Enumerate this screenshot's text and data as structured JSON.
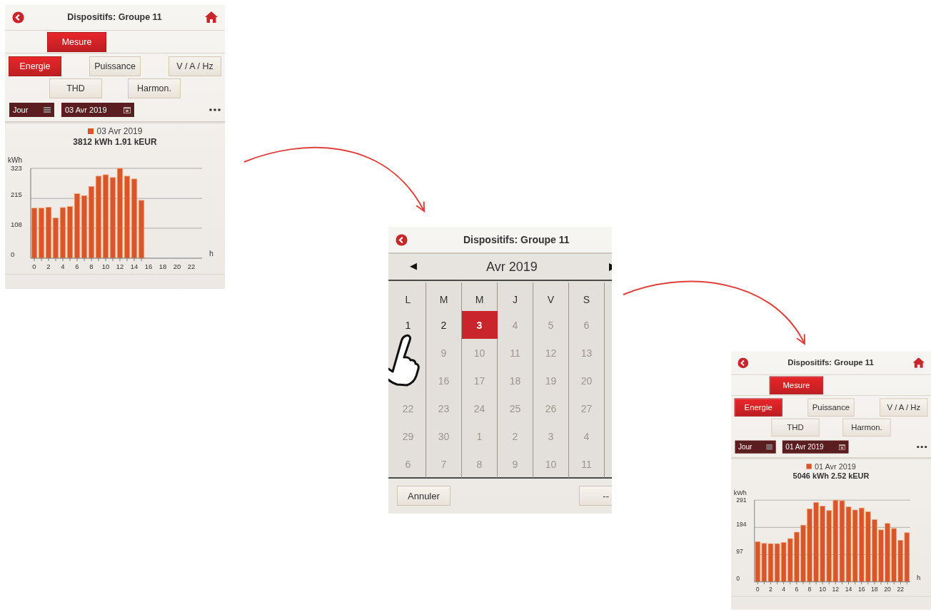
{
  "screens": [
    {
      "kind": "chart",
      "title": "Dispositifs: Groupe 11",
      "tabs": [
        {
          "label": "Mesure",
          "selected": true
        }
      ],
      "measure_rows": [
        [
          {
            "label": "Energie",
            "selected": true
          },
          {
            "label": "Puissance",
            "selected": false
          },
          {
            "label": "V / A / Hz",
            "selected": false
          }
        ],
        [
          {
            "label": "THD",
            "selected": false
          },
          {
            "label": "Harmon.",
            "selected": false
          }
        ]
      ],
      "period": "Jour",
      "date": "03 Avr 2019",
      "total": "3812 kWh 1.91 kEUR",
      "chart_data": {
        "type": "bar",
        "xlabel": "h",
        "ylabel": "kWh",
        "x": [
          0,
          1,
          2,
          3,
          4,
          5,
          6,
          7,
          8,
          9,
          10,
          11,
          12,
          13,
          14,
          15
        ],
        "series": [
          {
            "name": "03 Avr 2019",
            "color": "#d9552a",
            "values": [
              180,
              180,
              183,
              145,
              182,
              186,
              232,
              225,
              258,
              295,
              300,
              290,
              323,
              295,
              285,
              208
            ]
          }
        ],
        "xlim": [
          -0.5,
          23.5
        ],
        "ylim": [
          0,
          323
        ],
        "yticks": [
          0,
          108,
          215,
          323
        ],
        "xticks": [
          0,
          2,
          4,
          6,
          8,
          10,
          12,
          14,
          16,
          18,
          20,
          22
        ]
      }
    },
    {
      "kind": "calendar",
      "title": "Dispositifs: Groupe 11",
      "prev": "◀",
      "month": "Avr 2019",
      "weekdays": [
        "L",
        "M",
        "M",
        "J",
        "V",
        "S"
      ],
      "weeks": [
        [
          {
            "label": "1",
            "selected": false,
            "faded": false
          },
          {
            "label": "2",
            "selected": false,
            "faded": false
          },
          {
            "label": "3",
            "selected": true,
            "faded": false
          },
          {
            "label": "4",
            "selected": false,
            "faded": true
          },
          {
            "label": "5",
            "selected": false,
            "faded": true
          },
          {
            "label": "6",
            "selected": false,
            "faded": true
          }
        ],
        [
          {
            "kind": "covered"
          },
          {
            "label": "9",
            "selected": false,
            "faded": true
          },
          {
            "label": "10",
            "selected": false,
            "faded": true
          },
          {
            "label": "11",
            "selected": false,
            "faded": true
          },
          {
            "label": "12",
            "selected": false,
            "faded": true
          },
          {
            "label": "13",
            "selected": false,
            "faded": true
          }
        ],
        [
          {
            "kind": "covered"
          },
          {
            "label": "16",
            "selected": false,
            "faded": true
          },
          {
            "label": "17",
            "selected": false,
            "faded": true
          },
          {
            "label": "18",
            "selected": false,
            "faded": true
          },
          {
            "label": "19",
            "selected": false,
            "faded": true
          },
          {
            "label": "20",
            "selected": false,
            "faded": true
          }
        ],
        [
          {
            "label": "22",
            "selected": false,
            "faded": true
          },
          {
            "label": "23",
            "selected": false,
            "faded": true
          },
          {
            "label": "24",
            "selected": false,
            "faded": true
          },
          {
            "label": "25",
            "selected": false,
            "faded": true
          },
          {
            "label": "26",
            "selected": false,
            "faded": true
          },
          {
            "label": "27",
            "selected": false,
            "faded": true
          }
        ],
        [
          {
            "label": "29",
            "selected": false,
            "faded": true
          },
          {
            "label": "30",
            "selected": false,
            "faded": true
          },
          {
            "label": "1",
            "selected": false,
            "faded": true
          },
          {
            "label": "2",
            "selected": false,
            "faded": true
          },
          {
            "label": "3",
            "selected": false,
            "faded": true
          },
          {
            "label": "4",
            "selected": false,
            "faded": true
          }
        ],
        [
          {
            "label": "6",
            "selected": false,
            "faded": true
          },
          {
            "label": "7",
            "selected": false,
            "faded": true
          },
          {
            "label": "8",
            "selected": false,
            "faded": true
          },
          {
            "label": "9",
            "selected": false,
            "faded": true
          },
          {
            "label": "10",
            "selected": false,
            "faded": true
          },
          {
            "label": "11",
            "selected": false,
            "faded": true
          }
        ]
      ],
      "buttons": [
        "Annuler",
        "--"
      ]
    },
    {
      "kind": "chart",
      "title": "Dispositifs: Groupe 11",
      "tabs": [
        {
          "label": "Mesure",
          "selected": true
        }
      ],
      "measure_rows": [
        [
          {
            "label": "Energie",
            "selected": true
          },
          {
            "label": "Puissance",
            "selected": false
          },
          {
            "label": "V / A / Hz",
            "selected": false
          }
        ],
        [
          {
            "label": "THD",
            "selected": false
          },
          {
            "label": "Harmon.",
            "selected": false
          }
        ]
      ],
      "period": "Jour",
      "date": "01 Avr 2019",
      "total": "5046 kWh 2.52 kEUR",
      "chart_data": {
        "type": "bar",
        "xlabel": "h",
        "ylabel": "kWh",
        "x": [
          0,
          1,
          2,
          3,
          4,
          5,
          6,
          7,
          8,
          9,
          10,
          11,
          12,
          13,
          14,
          15,
          16,
          17,
          18,
          19,
          20,
          21,
          22,
          23
        ],
        "series": [
          {
            "name": "01 Avr 2019",
            "color": "#d9552a",
            "values": [
              143,
              137,
              136,
              136,
              140,
              154,
              177,
              202,
              260,
              283,
              270,
              254,
              291,
              289,
              267,
              256,
              263,
              250,
              222,
              185,
              208,
              190,
              148,
              175
            ]
          }
        ],
        "xlim": [
          -0.5,
          23.5
        ],
        "ylim": [
          0,
          291
        ],
        "yticks": [
          0,
          97,
          194,
          291
        ],
        "xticks": [
          0,
          2,
          4,
          6,
          8,
          10,
          12,
          14,
          16,
          18,
          20,
          22
        ]
      }
    }
  ]
}
